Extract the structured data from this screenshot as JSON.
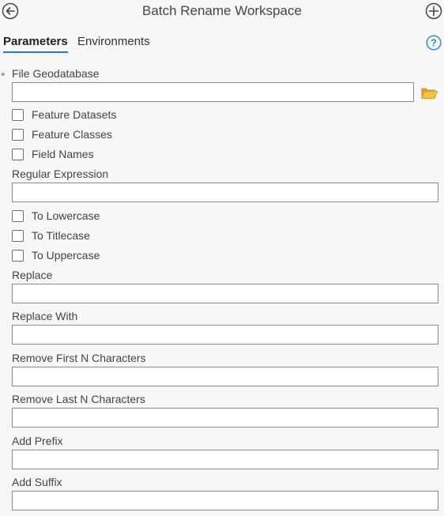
{
  "header": {
    "title": "Batch Rename Workspace",
    "back_icon": "back-arrow-icon",
    "add_icon": "plus-icon"
  },
  "tabs": [
    {
      "label": "Parameters",
      "active": true
    },
    {
      "label": "Environments",
      "active": false
    }
  ],
  "help_icon": "help-icon",
  "accent_color": "#1f7fc5",
  "required_marker": "*",
  "file_gdb": {
    "label": "File Geodatabase",
    "value": "",
    "browse_icon": "folder-icon"
  },
  "checkboxes_group1": [
    {
      "label": "Feature Datasets",
      "checked": false
    },
    {
      "label": "Feature Classes",
      "checked": false
    },
    {
      "label": "Field Names",
      "checked": false
    }
  ],
  "regex": {
    "label": "Regular Expression",
    "value": ""
  },
  "checkboxes_group2": [
    {
      "label": "To Lowercase",
      "checked": false
    },
    {
      "label": "To Titlecase",
      "checked": false
    },
    {
      "label": "To Uppercase",
      "checked": false
    }
  ],
  "replace": {
    "label": "Replace",
    "value": ""
  },
  "replace_with": {
    "label": "Replace With",
    "value": ""
  },
  "remove_first": {
    "label": "Remove First N Characters",
    "value": ""
  },
  "remove_last": {
    "label": "Remove Last N Characters",
    "value": ""
  },
  "add_prefix": {
    "label": "Add Prefix",
    "value": ""
  },
  "add_suffix": {
    "label": "Add Suffix",
    "value": ""
  }
}
